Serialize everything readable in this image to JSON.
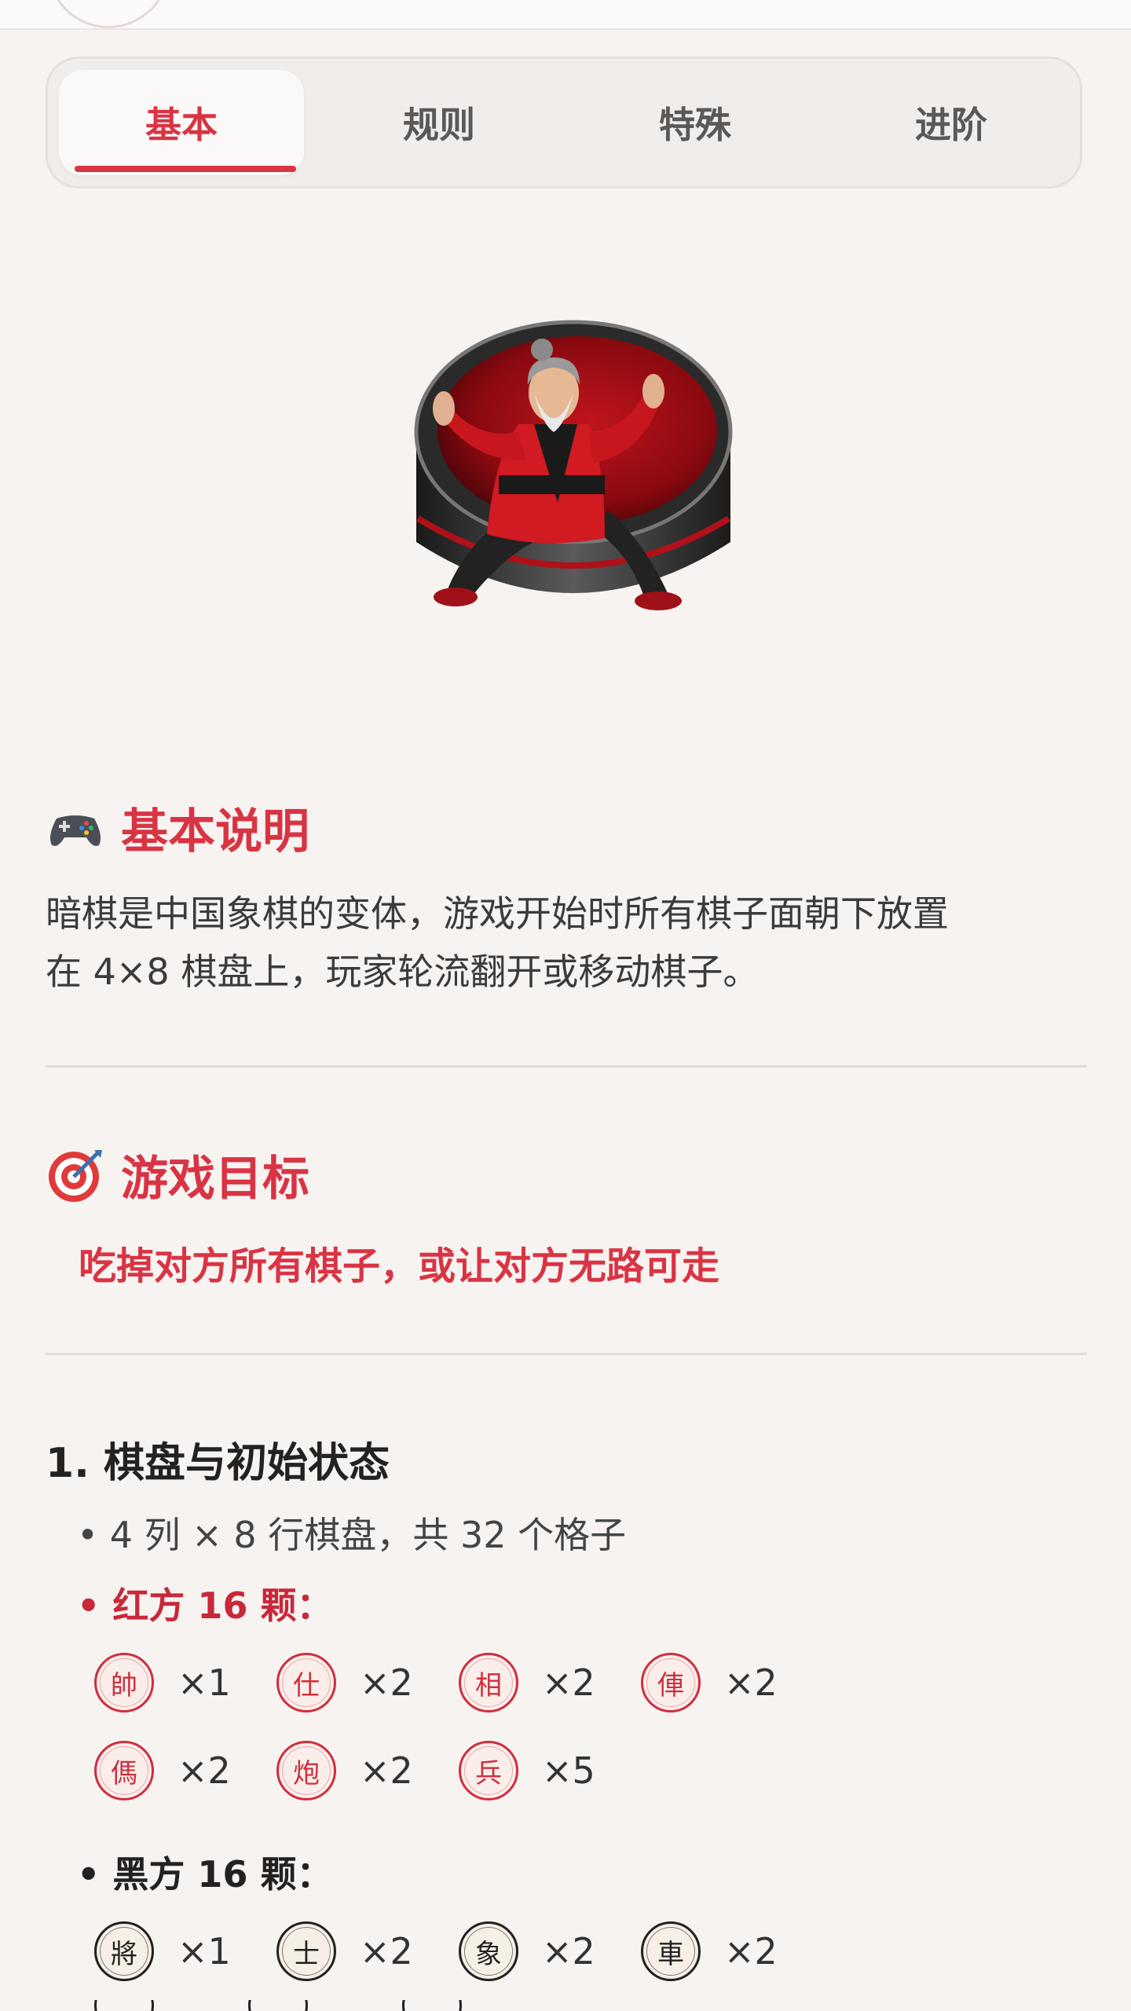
{
  "tabs": [
    {
      "label": "基本",
      "active": true
    },
    {
      "label": "规则",
      "active": false
    },
    {
      "label": "特殊",
      "active": false
    },
    {
      "label": "进阶",
      "active": false
    }
  ],
  "sections": {
    "basic": {
      "icon": "gamepad-icon",
      "title": "基本说明",
      "text_line1": "暗棋是中国象棋的变体，游戏开始时所有棋子面朝下放置",
      "text_line2": "在 4×8 棋盘上，玩家轮流翻开或移动棋子。"
    },
    "goal": {
      "icon": "target-icon",
      "title": "游戏目标",
      "text": "吃掉对方所有棋子，或让对方无路可走"
    },
    "board": {
      "heading": "1. 棋盘与初始状态",
      "bullet1": "• 4 列 × 8 行棋盘，共 32 个格子",
      "red_label": "• 红方 16 颗：",
      "black_label": "• 黑方 16 颗："
    }
  },
  "red_pieces": {
    "row1": [
      {
        "char": "帥",
        "count": "×1"
      },
      {
        "char": "仕",
        "count": "×2"
      },
      {
        "char": "相",
        "count": "×2"
      },
      {
        "char": "俥",
        "count": "×2"
      }
    ],
    "row2": [
      {
        "char": "傌",
        "count": "×2"
      },
      {
        "char": "炮",
        "count": "×2"
      },
      {
        "char": "兵",
        "count": "×5"
      }
    ]
  },
  "black_pieces": {
    "row1": [
      {
        "char": "將",
        "count": "×1"
      },
      {
        "char": "士",
        "count": "×2"
      },
      {
        "char": "象",
        "count": "×2"
      },
      {
        "char": "車",
        "count": "×2"
      }
    ]
  },
  "colors": {
    "accent": "#d93444",
    "background": "#f7f3f1",
    "black_piece": "#222222"
  }
}
